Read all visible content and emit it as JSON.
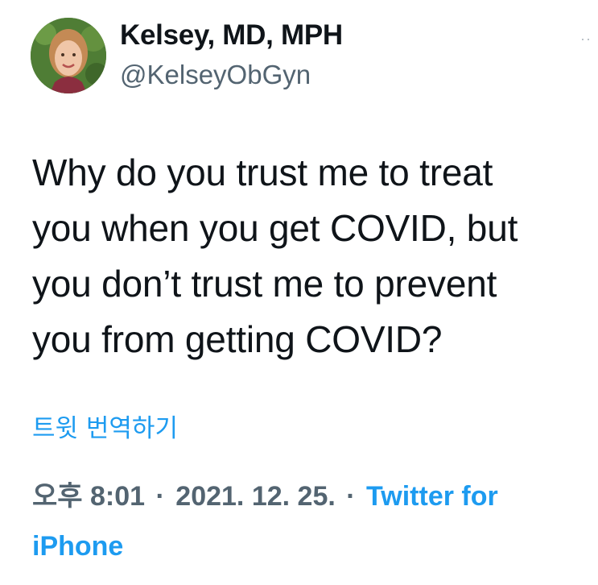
{
  "tweet": {
    "author_name": "Kelsey, MD, MPH",
    "handle": "@KelseyObGyn",
    "more_icon": "more-icon",
    "text": "Why do you trust me to treat\nyou when you get COVID, but\nyou don’t trust me to prevent\nyou from getting COVID?",
    "translate_label": "트윗 번역하기",
    "time": "오후 8:01",
    "separator": "·",
    "date": "2021. 12. 25.",
    "source": "Twitter for iPhone"
  },
  "colors": {
    "link": "#1d9bf0",
    "secondary_text": "#536471",
    "primary_text": "#0f1419"
  }
}
